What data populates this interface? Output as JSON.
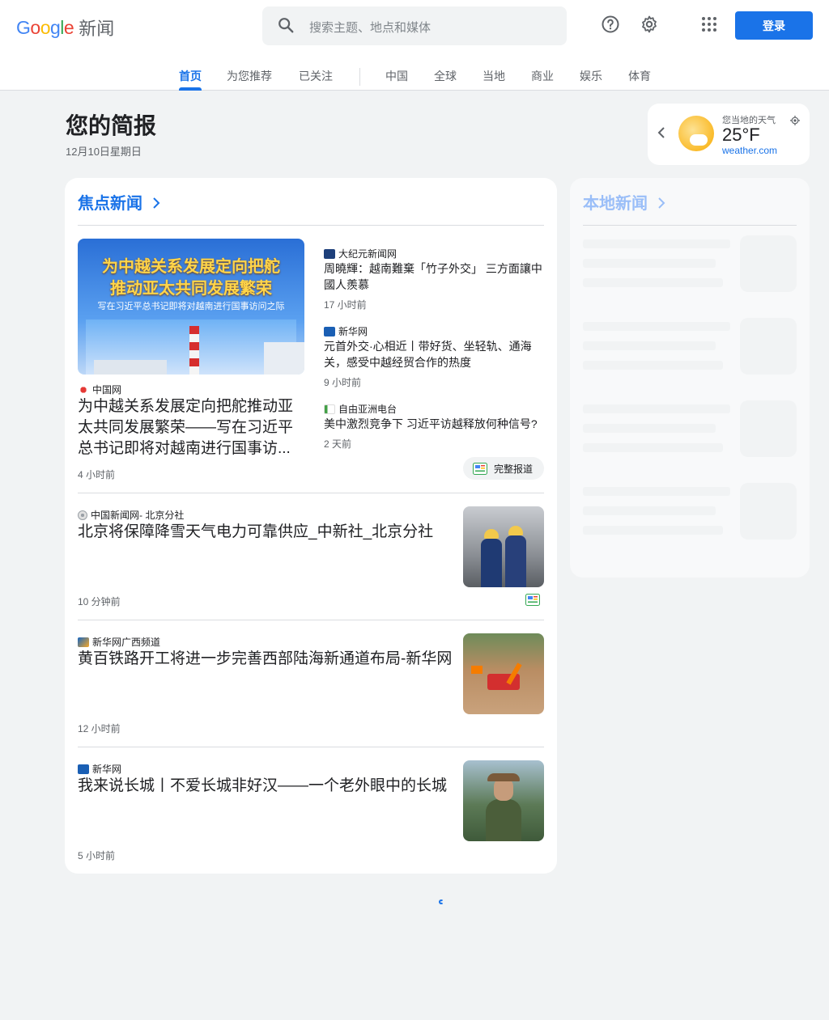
{
  "header": {
    "logo_google": "Google",
    "logo_news": "新闻",
    "search_placeholder": "搜索主题、地点和媒体",
    "login_label": "登录",
    "icons": [
      "search-icon",
      "help-icon",
      "settings-icon",
      "apps-icon"
    ]
  },
  "nav": {
    "tabs": [
      "首页",
      "为您推荐",
      "已关注",
      "中国",
      "全球",
      "当地",
      "商业",
      "娱乐",
      "体育"
    ],
    "active": "首页"
  },
  "briefing": {
    "title": "您的简报",
    "date": "12月10日星期日"
  },
  "weather": {
    "label": "您当地的天气",
    "temp": "25°F",
    "source": "weather.com"
  },
  "top_stories": {
    "title": "焦点新闻",
    "lead": {
      "image_text_line1": "为中越关系发展定向把舵",
      "image_text_line2": "推动亚太共同发展繁荣",
      "image_text_line3": "写在习近平总书记即将对越南进行国事访问之际",
      "source": "中国网",
      "headline": "为中越关系发展定向把舵推动亚太共同发展繁荣——写在习近平总书记即将对越南进行国事访...",
      "time": "4 小时前"
    },
    "related": [
      {
        "source": "大纪元新闻网",
        "headline": "周曉輝：越南難棄「竹子外交」 三方面讓中國人羨慕",
        "time": "17 小时前"
      },
      {
        "source": "新华网",
        "headline": "元首外交·心相近丨带好货、坐轻轨、通海关，感受中越经贸合作的热度",
        "time": "9 小时前"
      },
      {
        "source": "自由亚洲电台",
        "headline": "美中激烈竞争下 习近平访越释放何种信号?",
        "time": "2 天前"
      }
    ],
    "full_coverage": "完整报道",
    "stories": [
      {
        "source": "中国新闻网- 北京分社",
        "headline": "北京将保障降雪天气电力可靠供应_中新社_北京分社",
        "time": "10 分钟前"
      },
      {
        "source": "新华网广西频道",
        "headline": "黄百铁路开工将进一步完善西部陆海新通道布局-新华网",
        "time": "12 小时前"
      },
      {
        "source": "新华网",
        "headline": "我来说长城丨不爱长城非好汉——一个老外眼中的长城",
        "time": "5 小时前"
      }
    ]
  },
  "local_news": {
    "title": "本地新闻"
  },
  "colors": {
    "accent": "#1a73e8",
    "background": "#f1f3f4"
  }
}
